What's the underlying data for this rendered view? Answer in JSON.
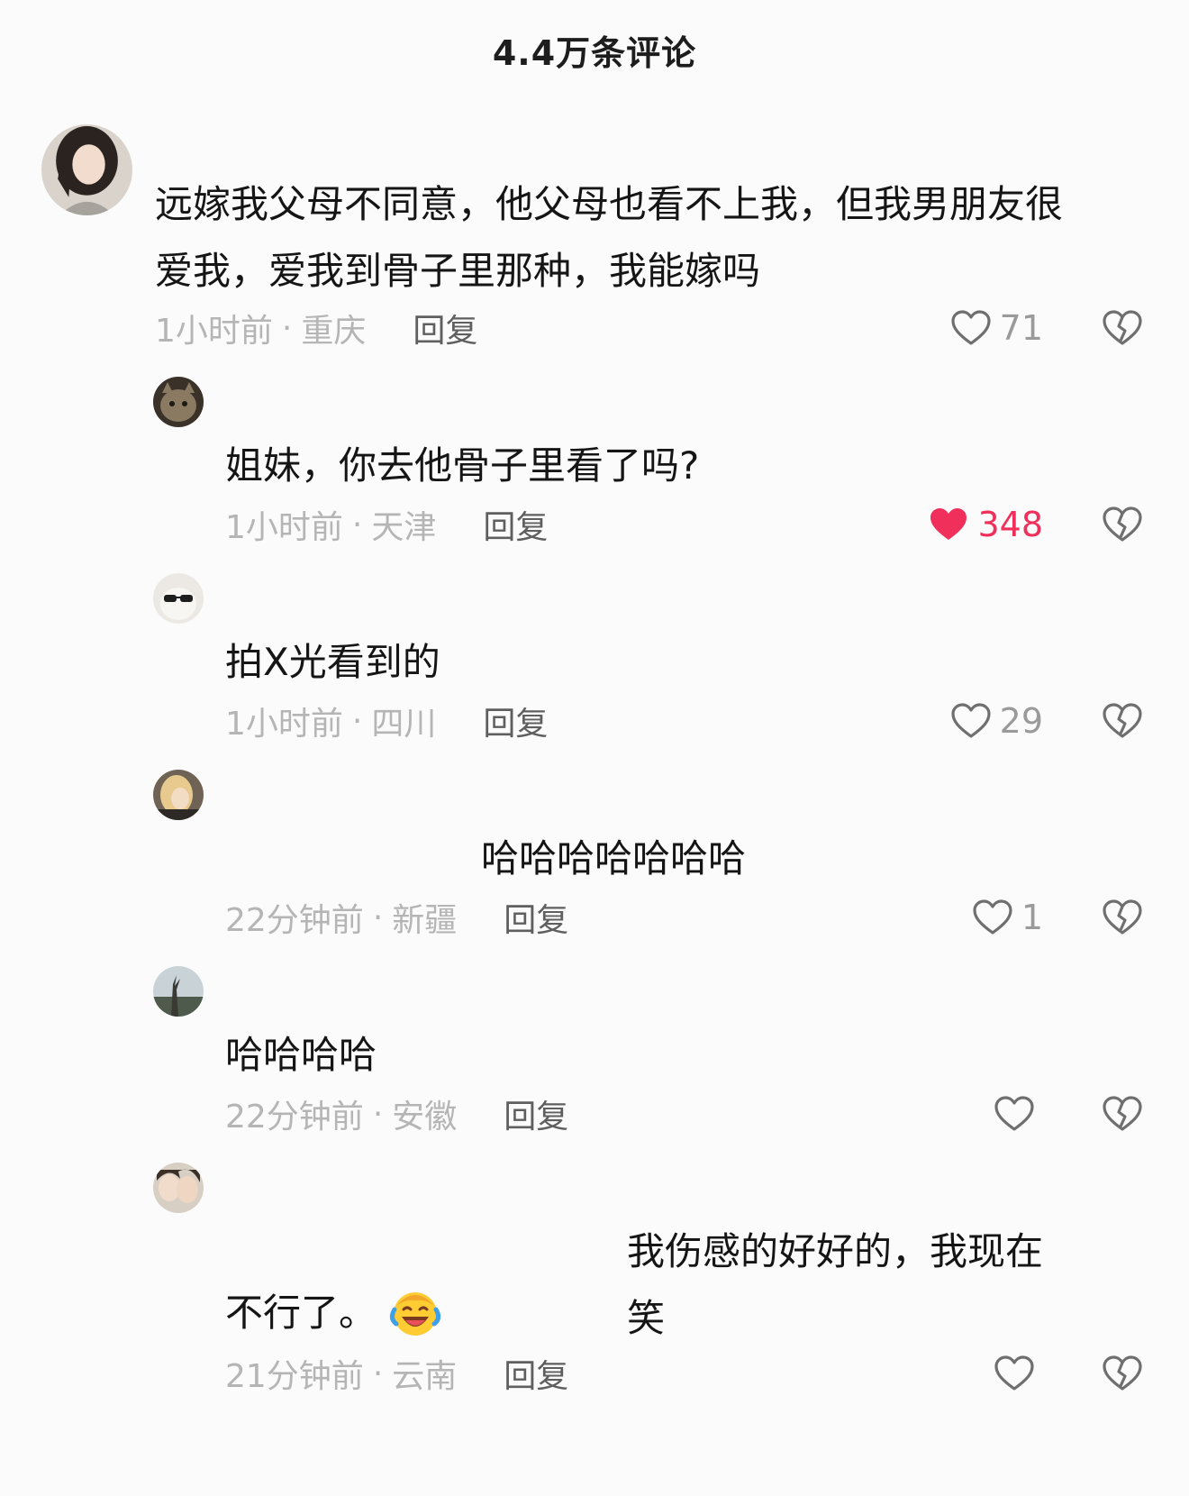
{
  "header": {
    "title": "4.4万条评论"
  },
  "comments": [
    {
      "content": "远嫁我父母不同意，他父母也看不上我，但我男朋友很爱我，爱我到骨子里那种，我能嫁吗",
      "time": "1小时前",
      "location": "重庆",
      "reply_label": "回复",
      "likes": "71"
    },
    {
      "content": "姐妹，你去他骨子里看了吗?",
      "time": "1小时前",
      "location": "天津",
      "reply_label": "回复",
      "likes": "348",
      "liked": true
    },
    {
      "content": "拍X光看到的",
      "time": "1小时前",
      "location": "四川",
      "reply_label": "回复",
      "likes": "29"
    },
    {
      "content": "哈哈哈哈哈哈哈",
      "time": "22分钟前",
      "location": "新疆",
      "reply_label": "回复",
      "likes": "1"
    },
    {
      "content": "哈哈哈哈",
      "time": "22分钟前",
      "location": "安徽",
      "reply_label": "回复",
      "likes": ""
    },
    {
      "content_line1": "我伤感的好好的，我现在笑",
      "content_line2": "不行了。",
      "emoji": "laughing-crying-emoji",
      "time": "21分钟前",
      "location": "云南",
      "reply_label": "回复",
      "likes": ""
    }
  ],
  "icons": {
    "like": "heart-outline-icon",
    "liked": "heart-filled-icon",
    "dislike": "broken-heart-icon"
  },
  "colors": {
    "liked": "#f0305a",
    "meta": "#b5b5b5",
    "reply": "#5f5f5f",
    "text": "#151515"
  },
  "separator": "·"
}
